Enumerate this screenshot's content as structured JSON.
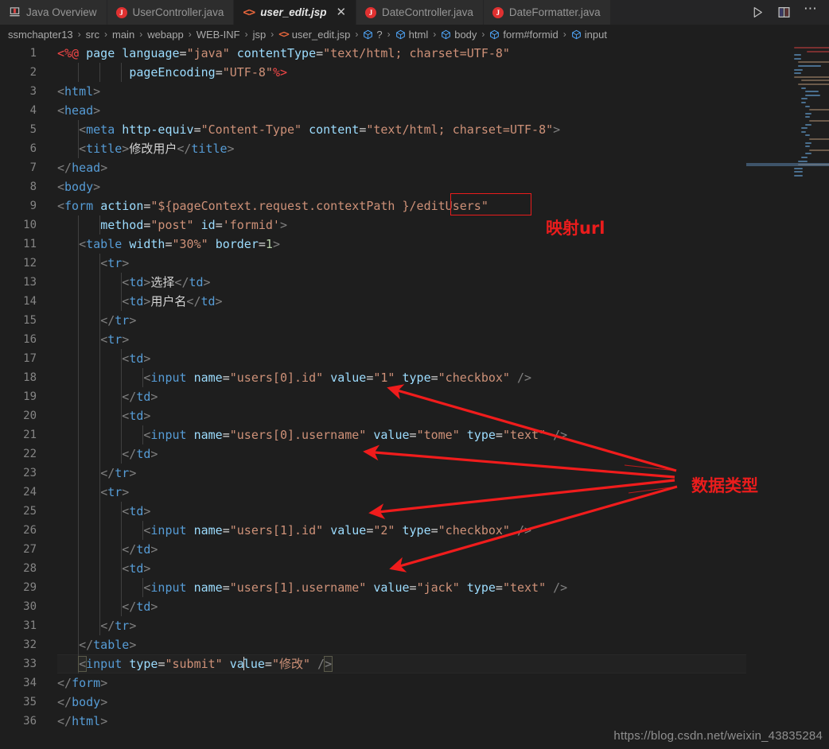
{
  "window": {
    "theme_bg": "#1e1e1e",
    "accent_red": "#ea1c1c"
  },
  "tabs": [
    {
      "label": "Java Overview",
      "icon": "java-overview-icon",
      "active": false,
      "closable": false
    },
    {
      "label": "UserController.java",
      "icon": "java-file-icon",
      "active": false,
      "closable": false
    },
    {
      "label": "user_edit.jsp",
      "icon": "jsp-file-icon",
      "active": true,
      "closable": true,
      "close_label": "✕"
    },
    {
      "label": "DateController.java",
      "icon": "java-file-icon",
      "active": false,
      "closable": false
    },
    {
      "label": "DateFormatter.java",
      "icon": "java-file-icon",
      "active": false,
      "closable": false
    }
  ],
  "tabbar_actions": [
    {
      "name": "run-button",
      "label": "▷"
    },
    {
      "name": "split-editor-button",
      "label": ""
    },
    {
      "name": "more-actions-button",
      "label": "⋯"
    }
  ],
  "breadcrumb": {
    "separator": "›",
    "items": [
      {
        "label": "ssmchapter13",
        "icon": "none"
      },
      {
        "label": "src",
        "icon": "none"
      },
      {
        "label": "main",
        "icon": "none"
      },
      {
        "label": "webapp",
        "icon": "none"
      },
      {
        "label": "WEB-INF",
        "icon": "none"
      },
      {
        "label": "jsp",
        "icon": "none"
      },
      {
        "label": "user_edit.jsp",
        "icon": "jsp-file-icon"
      },
      {
        "label": "?",
        "icon": "symbol-cube-icon"
      },
      {
        "label": "html",
        "icon": "symbol-cube-icon"
      },
      {
        "label": "body",
        "icon": "symbol-cube-icon"
      },
      {
        "label": "form#formid",
        "icon": "symbol-cube-icon"
      },
      {
        "label": "input",
        "icon": "symbol-cube-icon"
      }
    ]
  },
  "editor": {
    "language": "jsp",
    "current_line": 33,
    "total_lines": 36,
    "lines": [
      {
        "n": 1,
        "text": "<%@ page language=\"java\" contentType=\"text/html; charset=UTF-8\""
      },
      {
        "n": 2,
        "text": "          pageEncoding=\"UTF-8\"%>"
      },
      {
        "n": 3,
        "text": "<html>"
      },
      {
        "n": 4,
        "text": "<head>"
      },
      {
        "n": 5,
        "text": "   <meta http-equiv=\"Content-Type\" content=\"text/html; charset=UTF-8\">"
      },
      {
        "n": 6,
        "text": "   <title>修改用户</title>"
      },
      {
        "n": 7,
        "text": "</head>"
      },
      {
        "n": 8,
        "text": "<body>"
      },
      {
        "n": 9,
        "text": "<form action=\"${pageContext.request.contextPath }/editUsers\""
      },
      {
        "n": 10,
        "text": "      method=\"post\" id='formid'>"
      },
      {
        "n": 11,
        "text": "   <table width=\"30%\" border=1>"
      },
      {
        "n": 12,
        "text": "      <tr>"
      },
      {
        "n": 13,
        "text": "         <td>选择</td>"
      },
      {
        "n": 14,
        "text": "         <td>用户名</td>"
      },
      {
        "n": 15,
        "text": "      </tr>"
      },
      {
        "n": 16,
        "text": "      <tr>"
      },
      {
        "n": 17,
        "text": "         <td>"
      },
      {
        "n": 18,
        "text": "            <input name=\"users[0].id\" value=\"1\" type=\"checkbox\" />"
      },
      {
        "n": 19,
        "text": "         </td>"
      },
      {
        "n": 20,
        "text": "         <td>"
      },
      {
        "n": 21,
        "text": "            <input name=\"users[0].username\" value=\"tome\" type=\"text\" />"
      },
      {
        "n": 22,
        "text": "         </td>"
      },
      {
        "n": 23,
        "text": "      </tr>"
      },
      {
        "n": 24,
        "text": "      <tr>"
      },
      {
        "n": 25,
        "text": "         <td>"
      },
      {
        "n": 26,
        "text": "            <input name=\"users[1].id\" value=\"2\" type=\"checkbox\" />"
      },
      {
        "n": 27,
        "text": "         </td>"
      },
      {
        "n": 28,
        "text": "         <td>"
      },
      {
        "n": 29,
        "text": "            <input name=\"users[1].username\" value=\"jack\" type=\"text\" />"
      },
      {
        "n": 30,
        "text": "         </td>"
      },
      {
        "n": 31,
        "text": "      </tr>"
      },
      {
        "n": 32,
        "text": "   </table>"
      },
      {
        "n": 33,
        "text": "   <input type=\"submit\" value=\"修改\" />"
      },
      {
        "n": 34,
        "text": "</form>"
      },
      {
        "n": 35,
        "text": "</body>"
      },
      {
        "n": 36,
        "text": "</html>"
      }
    ]
  },
  "annotations": [
    {
      "name": "mapping-url-annotation",
      "label": "映射url"
    },
    {
      "name": "data-type-annotation",
      "label": "数据类型"
    }
  ],
  "watermark": {
    "text": "https://blog.csdn.net/weixin_43835284"
  }
}
